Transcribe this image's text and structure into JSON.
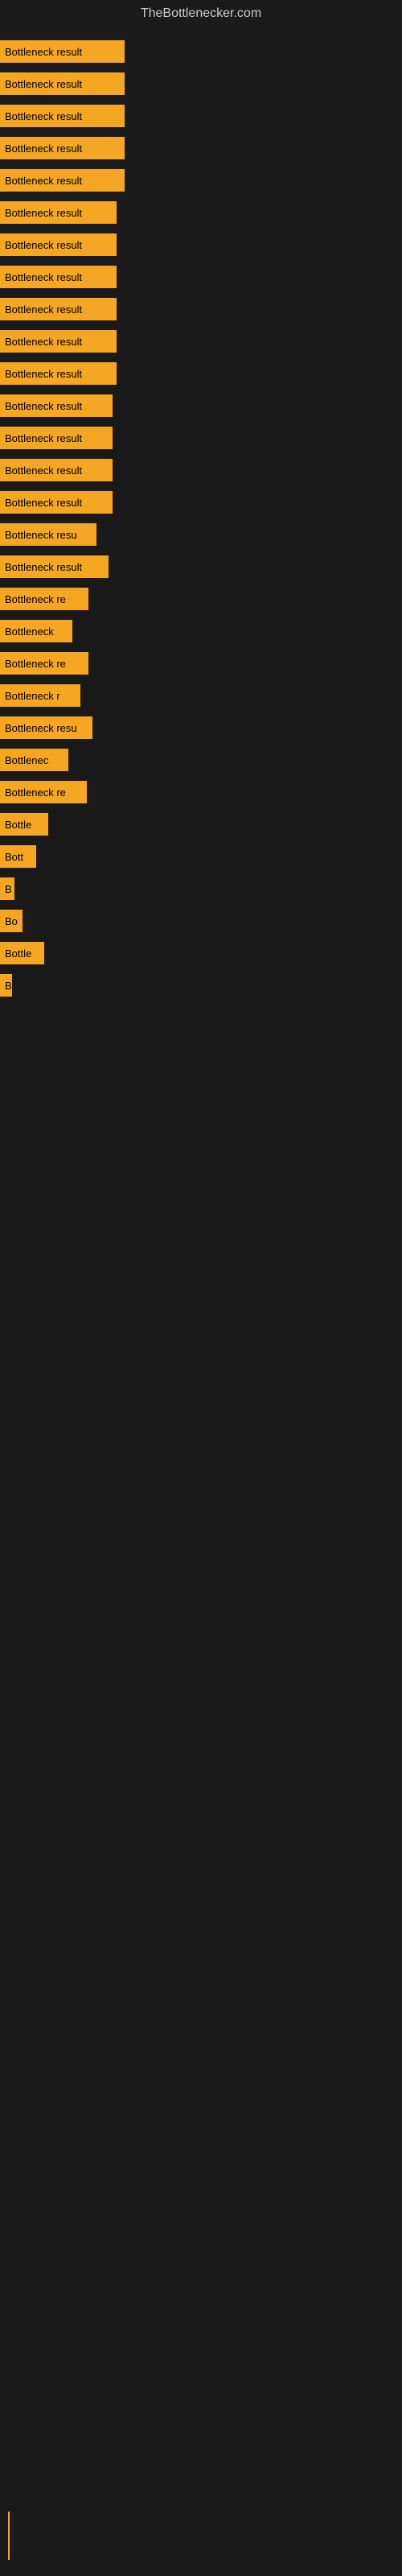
{
  "site": {
    "title": "TheBottlenecker.com"
  },
  "bars": [
    {
      "label": "Bottleneck result",
      "width": 155
    },
    {
      "label": "Bottleneck result",
      "width": 155
    },
    {
      "label": "Bottleneck result",
      "width": 155
    },
    {
      "label": "Bottleneck result",
      "width": 155
    },
    {
      "label": "Bottleneck result",
      "width": 155
    },
    {
      "label": "Bottleneck result",
      "width": 145
    },
    {
      "label": "Bottleneck result",
      "width": 145
    },
    {
      "label": "Bottleneck result",
      "width": 145
    },
    {
      "label": "Bottleneck result",
      "width": 145
    },
    {
      "label": "Bottleneck result",
      "width": 145
    },
    {
      "label": "Bottleneck result",
      "width": 145
    },
    {
      "label": "Bottleneck result",
      "width": 140
    },
    {
      "label": "Bottleneck result",
      "width": 140
    },
    {
      "label": "Bottleneck result",
      "width": 140
    },
    {
      "label": "Bottleneck result",
      "width": 140
    },
    {
      "label": "Bottleneck resu",
      "width": 120
    },
    {
      "label": "Bottleneck result",
      "width": 135
    },
    {
      "label": "Bottleneck re",
      "width": 110
    },
    {
      "label": "Bottleneck",
      "width": 90
    },
    {
      "label": "Bottleneck re",
      "width": 110
    },
    {
      "label": "Bottleneck r",
      "width": 100
    },
    {
      "label": "Bottleneck resu",
      "width": 115
    },
    {
      "label": "Bottlenec",
      "width": 85
    },
    {
      "label": "Bottleneck re",
      "width": 108
    },
    {
      "label": "Bottle",
      "width": 60
    },
    {
      "label": "Bott",
      "width": 45
    },
    {
      "label": "B",
      "width": 18
    },
    {
      "label": "Bo",
      "width": 28
    },
    {
      "label": "Bottle",
      "width": 55
    },
    {
      "label": "B",
      "width": 15
    }
  ]
}
